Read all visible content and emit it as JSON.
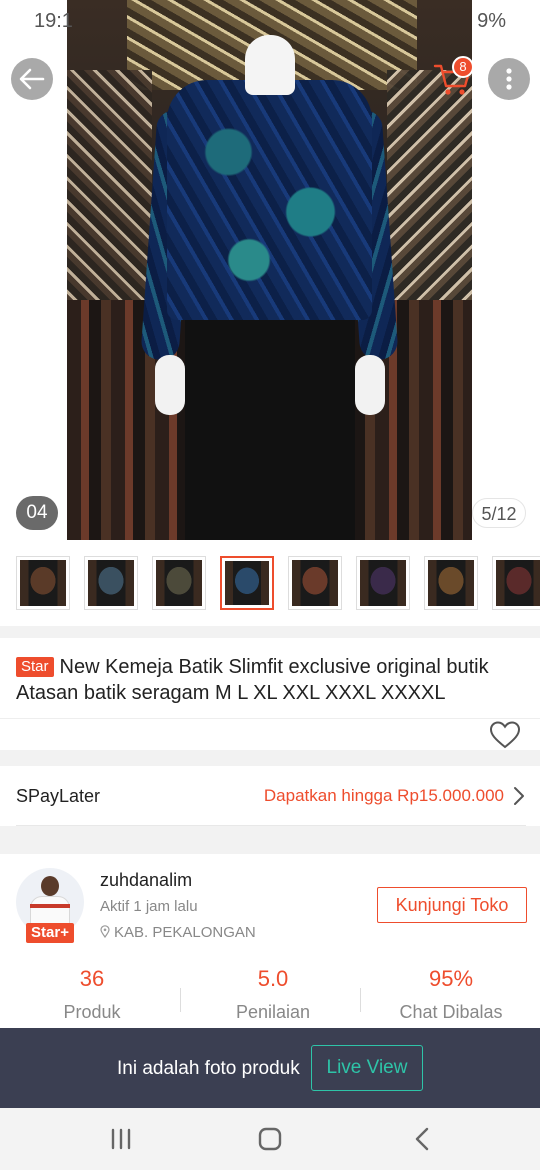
{
  "status": {
    "time": "19:1",
    "battery": "9%"
  },
  "cart": {
    "badge_count": "8"
  },
  "gallery": {
    "current_tag": "04",
    "counter": "5/12",
    "thumbnail_count": 9,
    "active_thumbnail": 4
  },
  "product": {
    "badge": "Star",
    "title": "New Kemeja Batik Slimfit exclusive original butik Atasan batik seragam M L XL XXL XXXL XXXXL"
  },
  "spaylater": {
    "label": "SPayLater",
    "offer": "Dapatkan hingga Rp15.000.000"
  },
  "shop": {
    "name": "zuhdanalim",
    "active": "Aktif 1 jam lalu",
    "location": "KAB. PEKALONGAN",
    "badge": "Star+",
    "visit_label": "Kunjungi Toko",
    "stats": [
      {
        "value": "36",
        "label": "Produk"
      },
      {
        "value": "5.0",
        "label": "Penilaian"
      },
      {
        "value": "95%",
        "label": "Chat Dibalas"
      }
    ]
  },
  "live_bar": {
    "text": "Ini adalah foto produk",
    "button": "Live View"
  },
  "colors": {
    "accent": "#ee4d2d",
    "teal": "#2ec4a8",
    "dark_bar": "#3b3f52"
  },
  "icons": [
    "back-arrow-icon",
    "cart-icon",
    "more-vertical-icon",
    "heart-icon",
    "chevron-right-icon",
    "location-pin-icon",
    "recent-apps-icon",
    "home-icon",
    "back-nav-icon"
  ]
}
